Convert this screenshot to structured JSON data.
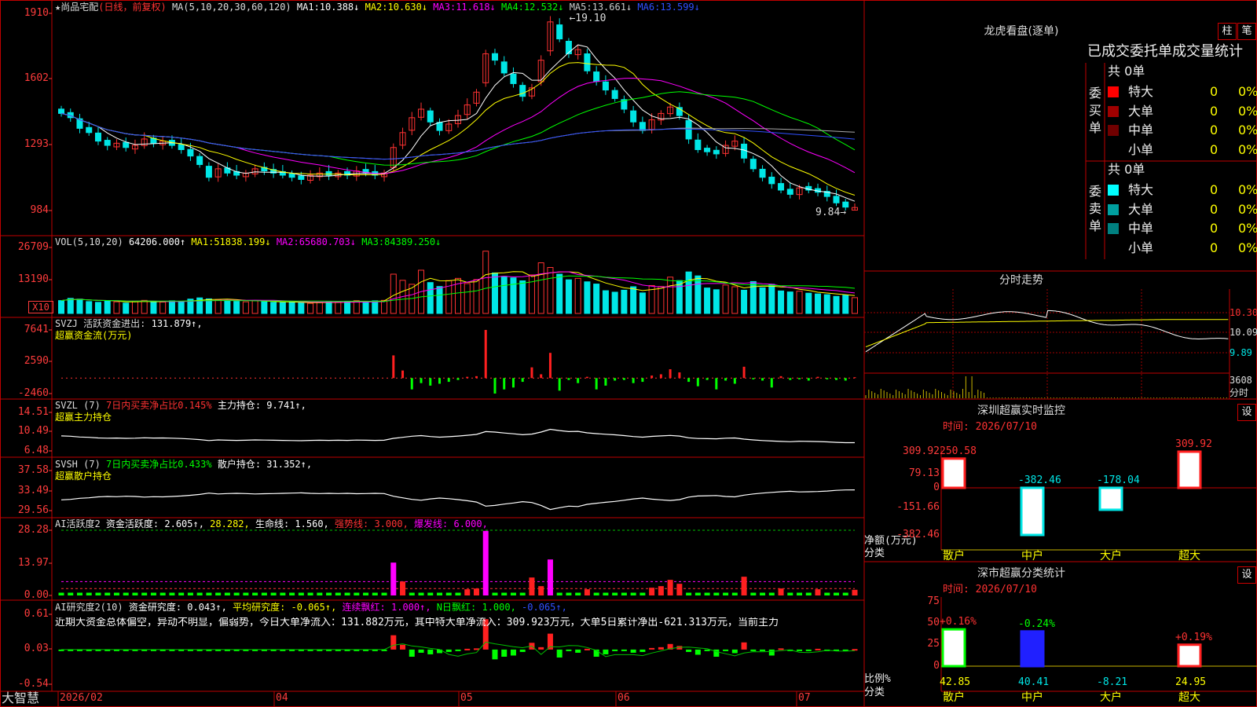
{
  "stock": {
    "name": "尚品宅配",
    "period": "(日线，前复权)"
  },
  "colors": {
    "up": "#ff3232",
    "down": "#00e6e6",
    "grid": "#a00000",
    "bg": "#000000",
    "axis_text": "#ff3c3c"
  },
  "price_panel": {
    "ma_header": "MA(5,10,20,30,60,120)",
    "ma": [
      {
        "label": "MA1:",
        "value": "10.388↓",
        "color": "#ffffff"
      },
      {
        "label": "MA2:",
        "value": "10.630↓",
        "color": "#ffff00"
      },
      {
        "label": "MA3:",
        "value": "11.618↓",
        "color": "#ff00ff"
      },
      {
        "label": "MA4:",
        "value": "12.532↓",
        "color": "#00ff00"
      },
      {
        "label": "MA5:",
        "value": "13.661↓",
        "color": "#cccccc"
      },
      {
        "label": "MA6:",
        "value": "13.599↓",
        "color": "#3050ff"
      }
    ],
    "y_ticks": [
      "1910",
      "1602",
      "1293",
      "984"
    ],
    "high_label": "19.10",
    "low_label": "9.84"
  },
  "vol_panel": {
    "header": "VOL(5,10,20)",
    "value": "64206.000↑",
    "ma": [
      {
        "label": "MA1:",
        "value": "51838.199↓",
        "color": "#ffff00"
      },
      {
        "label": "MA2:",
        "value": "65680.703↓",
        "color": "#ff00ff"
      },
      {
        "label": "MA3:",
        "value": "84389.250↓",
        "color": "#00ff00"
      }
    ],
    "y_ticks": [
      "26709",
      "13190"
    ],
    "unit": "X10"
  },
  "svzj_panel": {
    "header": "SVZJ  活跃资金进出:",
    "value": "131.879↑,",
    "subtitle": "超赢资金流(万元)",
    "y_ticks": [
      "7641",
      "2590",
      "-2460"
    ]
  },
  "svzl_panel": {
    "header": "SVZL (7)",
    "metric": "7日内买卖净占比0.145%",
    "holding": "主力持仓: 9.741↑,",
    "subtitle": "超赢主力持仓",
    "y_ticks": [
      "14.51",
      "10.49",
      "6.48"
    ]
  },
  "svsh_panel": {
    "header": "SVSH (7)",
    "metric": "7日内买卖净占比0.433%",
    "holding": "散户持仓: 31.352↑,",
    "subtitle": "超赢散户持仓",
    "y_ticks": [
      "37.58",
      "33.49",
      "29.56"
    ]
  },
  "ai_active_panel": {
    "header": "AI活跃度2",
    "items": [
      {
        "text": "资金活跃度: 2.605↑,",
        "color": "#ffffff"
      },
      {
        "text": "28.282,",
        "color": "#ffff00"
      },
      {
        "text": "生命线: 1.560,",
        "color": "#ffffff"
      },
      {
        "text": "强势线: 3.000,",
        "color": "#ff3232"
      },
      {
        "text": "爆发线: 6.000,",
        "color": "#ff00ff"
      }
    ],
    "y_ticks": [
      "28.28",
      "13.97",
      "0.00"
    ]
  },
  "ai_research_panel": {
    "header": "AI研究度2(10)",
    "items": [
      {
        "text": "资金研究度: 0.043↑,",
        "color": "#ffffff"
      },
      {
        "text": "平均研究度: -0.065↑,",
        "color": "#ffff00"
      },
      {
        "text": "连续飘红: 1.000↑,",
        "color": "#ff00ff"
      },
      {
        "text": "N日飘红: 1.000,",
        "color": "#00ff00"
      },
      {
        "text": "-0.065↑,",
        "color": "#3050ff"
      }
    ],
    "comment": "近期大资金总体偏空，异动不明显，偏弱势，今日大单净流入：131.882万元，其中特大单净流入：309.923万元，大单5日累计净出-621.313万元，当前主力",
    "y_ticks": [
      "0.61",
      "0.03",
      "-0.54"
    ]
  },
  "x_axis": {
    "brand": "大智慧",
    "labels": [
      "2026/02",
      "04",
      "05",
      "06",
      "07"
    ]
  },
  "dragon_tiger": {
    "title": "龙虎看盘(逐单)",
    "btn_bar": "柱",
    "btn_tick": "笔",
    "header": "已成交委托单成交量统计",
    "buy": {
      "side_label": "委买单",
      "total": "共 0单",
      "rows": [
        {
          "name": "特大",
          "count": "0",
          "pct": "0%",
          "color": "#ff0000"
        },
        {
          "name": "大单",
          "count": "0",
          "pct": "0%",
          "color": "#a00000"
        },
        {
          "name": "中单",
          "count": "0",
          "pct": "0%",
          "color": "#700000"
        },
        {
          "name": "小单",
          "count": "0",
          "pct": "0%",
          "color": "#000000"
        }
      ]
    },
    "sell": {
      "side_label": "委卖单",
      "total": "共 0单",
      "rows": [
        {
          "name": "特大",
          "count": "0",
          "pct": "0%",
          "color": "#00ffff"
        },
        {
          "name": "大单",
          "count": "0",
          "pct": "0%",
          "color": "#00a0a0"
        },
        {
          "name": "中单",
          "count": "0",
          "pct": "0%",
          "color": "#008080"
        },
        {
          "name": "小单",
          "count": "0",
          "pct": "0%",
          "color": "#000000"
        }
      ]
    }
  },
  "intraday": {
    "title": "分时走势",
    "price_ticks": [
      "10.30",
      "10.09",
      "9.89"
    ],
    "vol_ticks": [
      "3608",
      "分时"
    ]
  },
  "sz_monitor": {
    "title": "深圳超赢实时监控",
    "settings": "设",
    "time_label": "时间: 2026/07/10",
    "y_ticks": [
      "309.92",
      "79.13",
      "0",
      "-151.66",
      "-382.46"
    ],
    "y_title": "净额(万元)",
    "x_title": "分类",
    "chart_data": {
      "type": "bar",
      "categories": [
        "散户",
        "中户",
        "大户",
        "超大"
      ],
      "values": [
        250.58,
        -382.46,
        -178.04,
        309.92
      ],
      "ylim": [
        -382.46,
        309.92
      ]
    }
  },
  "sz_category": {
    "title": "深市超赢分类统计",
    "settings": "设",
    "time_label": "时间: 2026/07/10",
    "y_ticks": [
      "75",
      "50",
      "25",
      "0"
    ],
    "y_title": "比例%",
    "x_title": "分类",
    "chart_data": {
      "type": "bar",
      "categories": [
        "散户",
        "中户",
        "大户",
        "超大"
      ],
      "values": [
        42.85,
        40.41,
        -8.21,
        24.95
      ],
      "change_labels": [
        "+0.16%",
        "-0.24%",
        "",
        "+0.19%"
      ],
      "ylim": [
        0,
        75
      ]
    }
  },
  "chart_data": [
    {
      "type": "candlestick",
      "title": "尚品宅配(日线，前复权)",
      "ylim": [
        9.84,
        19.1
      ],
      "x": [
        "2026/02",
        "04",
        "05",
        "06",
        "07"
      ],
      "close": [
        14.4,
        14.2,
        13.7,
        13.5,
        13.1,
        12.9,
        13.0,
        12.8,
        12.9,
        13.2,
        13.0,
        13.1,
        12.9,
        12.7,
        12.4,
        12.0,
        11.4,
        11.8,
        11.6,
        11.5,
        11.6,
        11.8,
        11.7,
        11.6,
        11.5,
        11.4,
        11.3,
        11.5,
        11.6,
        11.5,
        11.6,
        11.5,
        11.7,
        11.6,
        11.5,
        11.6,
        12.8,
        13.5,
        14.2,
        14.6,
        14.0,
        13.6,
        13.9,
        14.3,
        14.8,
        15.4,
        17.2,
        16.9,
        16.3,
        15.8,
        15.2,
        15.6,
        16.9,
        18.7,
        17.9,
        17.2,
        17.4,
        16.4,
        15.9,
        15.5,
        15.1,
        14.6,
        14.0,
        13.6,
        14.1,
        14.4,
        14.7,
        14.3,
        13.2,
        12.7,
        12.6,
        12.5,
        12.9,
        13.1,
        12.3,
        11.8,
        11.4,
        11.1,
        10.8,
        10.6,
        10.9,
        10.8,
        10.7,
        10.5,
        10.2,
        10.0,
        9.98
      ],
      "up": [
        false,
        false,
        false,
        false,
        false,
        false,
        true,
        false,
        true,
        true,
        false,
        true,
        false,
        false,
        false,
        false,
        false,
        true,
        false,
        false,
        true,
        true,
        false,
        false,
        false,
        false,
        false,
        true,
        true,
        false,
        true,
        false,
        true,
        false,
        false,
        true,
        true,
        true,
        true,
        true,
        false,
        false,
        true,
        true,
        true,
        true,
        true,
        false,
        false,
        false,
        false,
        true,
        true,
        true,
        false,
        false,
        true,
        false,
        false,
        false,
        false,
        false,
        false,
        false,
        true,
        true,
        true,
        false,
        false,
        false,
        false,
        false,
        true,
        true,
        false,
        false,
        false,
        false,
        false,
        false,
        true,
        false,
        false,
        false,
        false,
        false,
        true
      ]
    },
    {
      "type": "bar",
      "title": "VOL(5,10,20)",
      "ylim": [
        0,
        26709
      ],
      "values": [
        5200,
        6100,
        5800,
        4800,
        4500,
        5100,
        4700,
        4200,
        4900,
        5300,
        4800,
        4600,
        5100,
        4900,
        5800,
        6300,
        5900,
        5600,
        5300,
        4900,
        4700,
        5200,
        4800,
        4500,
        4400,
        4600,
        4300,
        4100,
        4500,
        4700,
        4600,
        4800,
        5200,
        4900,
        5100,
        5300,
        15900,
        13400,
        11800,
        17500,
        12500,
        10900,
        13300,
        14200,
        12100,
        13700,
        25200,
        16400,
        15000,
        14400,
        13200,
        15600,
        20500,
        18600,
        15900,
        13600,
        14200,
        12800,
        11900,
        9200,
        8600,
        9400,
        10800,
        8300,
        11300,
        10900,
        14700,
        13300,
        16800,
        15200,
        10300,
        9600,
        11500,
        10800,
        9400,
        12900,
        10400,
        11800,
        9100,
        8700,
        9000,
        8200,
        7900,
        7600,
        6900,
        7400,
        6400
      ]
    },
    {
      "type": "bar",
      "title": "SVZJ 活跃资金进出",
      "ylim": [
        -2460,
        7641
      ],
      "values": [
        0,
        0,
        0,
        0,
        0,
        0,
        0,
        0,
        0,
        0,
        0,
        0,
        0,
        0,
        0,
        0,
        0,
        0,
        0,
        0,
        0,
        0,
        0,
        0,
        0,
        0,
        0,
        0,
        0,
        0,
        0,
        0,
        0,
        0,
        0,
        0,
        3600,
        1200,
        -1800,
        -800,
        -1200,
        -900,
        -600,
        -300,
        200,
        300,
        7641,
        -2460,
        -1800,
        -1500,
        -600,
        1700,
        600,
        4000,
        -2000,
        -300,
        -800,
        200,
        -1800,
        -1200,
        -400,
        -300,
        -800,
        -600,
        400,
        600,
        1400,
        900,
        -600,
        -1300,
        -300,
        -1800,
        -400,
        -900,
        1800,
        -200,
        -400,
        -1500,
        300,
        -300,
        -200,
        -400,
        200,
        -200,
        -300,
        -400,
        131.879
      ]
    }
  ]
}
